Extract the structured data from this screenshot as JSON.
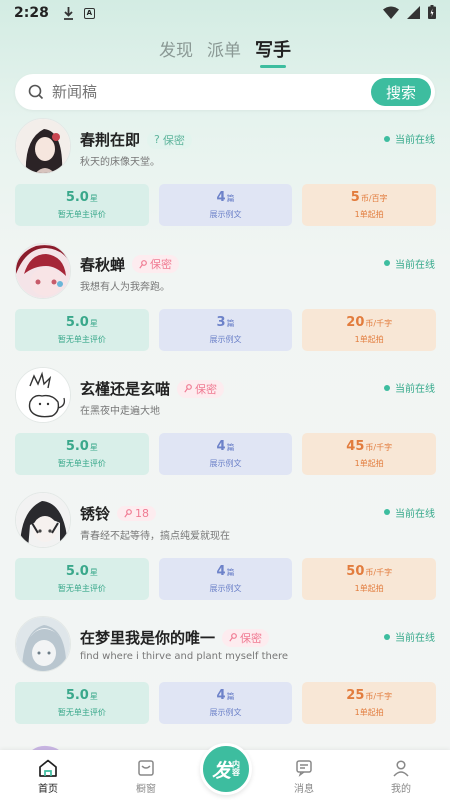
{
  "status_bar": {
    "time": "2:28",
    "sim_label": "A"
  },
  "top_tabs": [
    {
      "label": "发现",
      "active": false
    },
    {
      "label": "派单",
      "active": false
    },
    {
      "label": "写手",
      "active": true
    }
  ],
  "search": {
    "placeholder": "新闻稿",
    "button_label": "搜索"
  },
  "writers": [
    {
      "name": "春荆在即",
      "badge": "保密",
      "badge_icon": "question-icon",
      "bio": "秋天的床像天堂。",
      "status": "当前在线",
      "rating": "5.0",
      "rating_unit": "星",
      "rating_label": "暂无单主评价",
      "samples": "4",
      "samples_unit": "篇",
      "samples_label": "展示例文",
      "price": "5",
      "price_unit": "币/百字",
      "price_label": "1单起拍"
    },
    {
      "name": "春秋蝉",
      "badge": "保密",
      "badge_icon": "female-icon",
      "bio": "我想有人为我奔跑。",
      "status": "当前在线",
      "rating": "5.0",
      "rating_unit": "星",
      "rating_label": "暂无单主评价",
      "samples": "3",
      "samples_unit": "篇",
      "samples_label": "展示例文",
      "price": "20",
      "price_unit": "币/千字",
      "price_label": "1单起拍"
    },
    {
      "name": "玄槿还是玄喵",
      "badge": "保密",
      "badge_icon": "female-icon",
      "bio": "在黑夜中走遍大地",
      "status": "当前在线",
      "rating": "5.0",
      "rating_unit": "星",
      "rating_label": "暂无单主评价",
      "samples": "4",
      "samples_unit": "篇",
      "samples_label": "展示例文",
      "price": "45",
      "price_unit": "币/千字",
      "price_label": "1单起拍"
    },
    {
      "name": "锈铃",
      "badge": "18",
      "badge_icon": "female-icon",
      "bio": "青春经不起等待，搞点纯爱就现在",
      "status": "当前在线",
      "rating": "5.0",
      "rating_unit": "星",
      "rating_label": "暂无单主评价",
      "samples": "4",
      "samples_unit": "篇",
      "samples_label": "展示例文",
      "price": "50",
      "price_unit": "币/千字",
      "price_label": "1单起拍"
    },
    {
      "name": "在梦里我是你的唯一",
      "badge": "保密",
      "badge_icon": "female-icon",
      "bio": "find where i thirve and plant myself there",
      "status": "当前在线",
      "rating": "5.0",
      "rating_unit": "星",
      "rating_label": "暂无单主评价",
      "samples": "4",
      "samples_unit": "篇",
      "samples_label": "展示例文",
      "price": "25",
      "price_unit": "币/千字",
      "price_label": "1单起拍"
    }
  ],
  "bottom_nav": [
    {
      "label": "首页",
      "icon": "home-icon",
      "active": true
    },
    {
      "label": "橱窗",
      "icon": "showcase-icon",
      "active": false
    },
    {
      "label": "消息",
      "icon": "message-icon",
      "active": false
    },
    {
      "label": "我的",
      "icon": "profile-icon",
      "active": false
    }
  ],
  "publish": {
    "main": "发",
    "sub1": "内",
    "sub2": "容"
  },
  "colors": {
    "accent": "#3dbd9f",
    "badge_pink": "#f07b93",
    "price_orange": "#e27c3d",
    "samples_blue": "#6d82c9"
  }
}
